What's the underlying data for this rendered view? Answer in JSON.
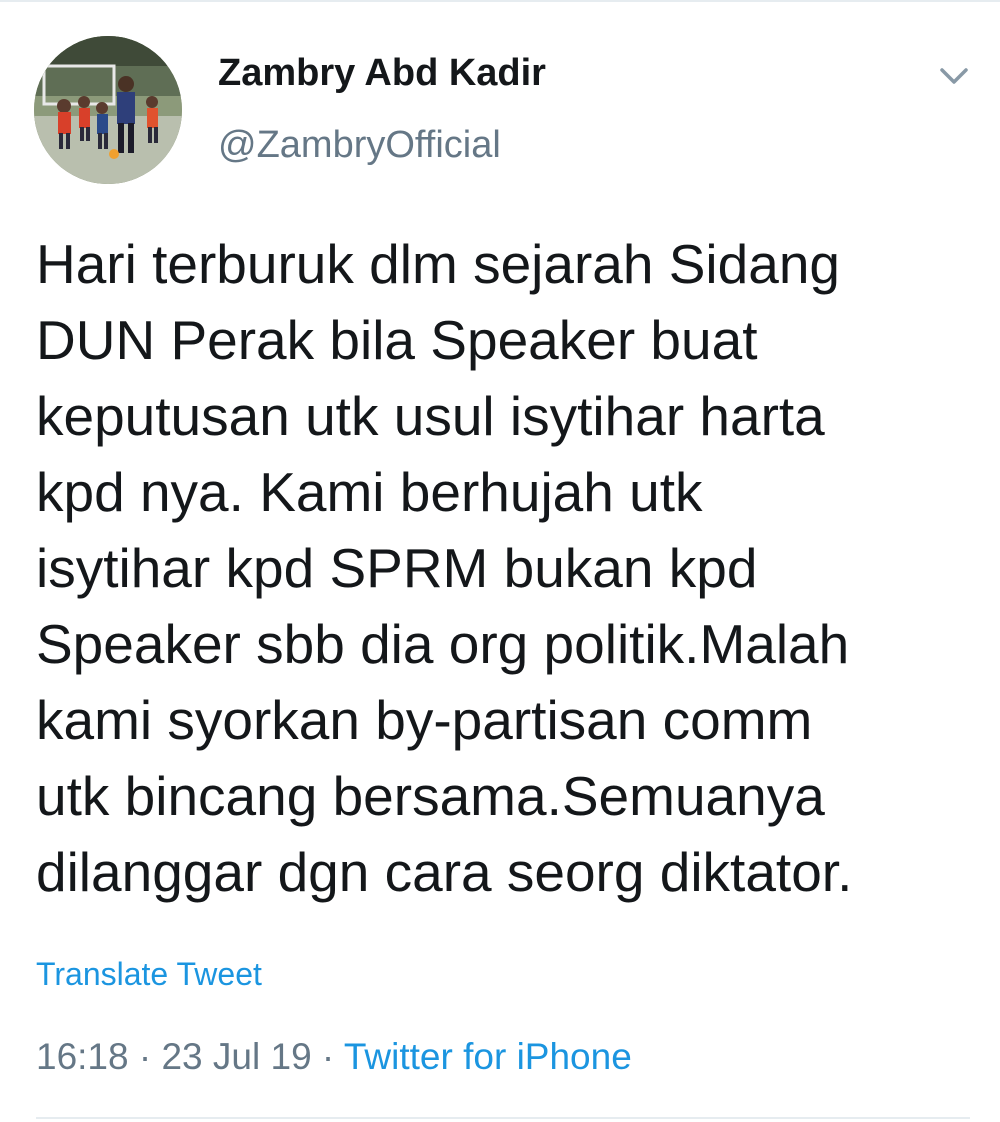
{
  "tweet": {
    "author": {
      "display_name": "Zambry Abd Kadir",
      "handle": "@ZambryOfficial",
      "avatar_icon": "profile-photo-football-field"
    },
    "text": "Hari terburuk dlm sejarah Sidang\nDUN Perak bila Speaker buat\nkeputusan utk usul isytihar harta\nkpd nya. Kami berhujah utk\nisytihar kpd SPRM bukan kpd\nSpeaker sbb dia org politik.Malah\nkami syorkan by-partisan comm\nutk bincang bersama.Semuanya\ndilanggar dgn cara seorg diktator.",
    "translate_label": "Translate Tweet",
    "time": "16:18",
    "separator": " · ",
    "date": "23 Jul 19",
    "source": "Twitter for iPhone",
    "menu_icon": "chevron-down-icon"
  },
  "colors": {
    "text": "#14171a",
    "secondary": "#657786",
    "link": "#1b95e0",
    "divider": "#e6ecf0"
  }
}
